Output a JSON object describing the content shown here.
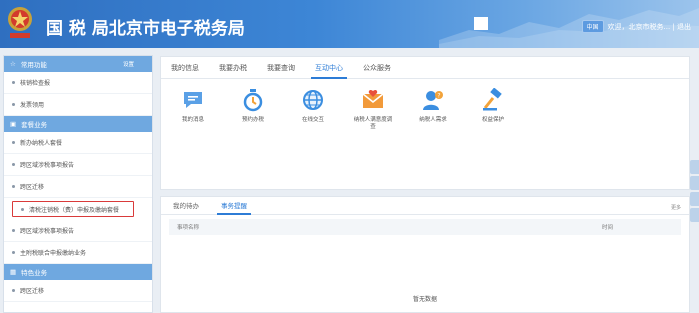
{
  "header": {
    "title": "国 税 局北京市电子税务局",
    "user_pill": "中国",
    "user_links": "欢迎，北京市税务... | 退出"
  },
  "sidebar": {
    "section1": {
      "icon": "star-icon",
      "title": "常用功能",
      "right": "设置"
    },
    "items1": [
      {
        "label": "核销检查报"
      },
      {
        "label": "发票领用"
      }
    ],
    "section2": {
      "icon": "briefcase-icon",
      "title": "套餐业务"
    },
    "items2": [
      {
        "label": "新办纳税人套餐"
      },
      {
        "label": "跨区域涉税事项报告"
      },
      {
        "label": "跨区迁移"
      },
      {
        "label": "清税注销税（费）申报及缴纳套餐"
      },
      {
        "label": "跨区域涉税事项报告"
      },
      {
        "label": "主附税联合申报缴纳业务"
      }
    ],
    "section3": {
      "icon": "grid-icon",
      "title": "特色业务"
    },
    "items3": [
      {
        "label": "跨区迁移"
      }
    ]
  },
  "main": {
    "tabs": [
      "我的信息",
      "我要办税",
      "我要查询",
      "互动中心",
      "公众服务"
    ],
    "active_tab": 3,
    "icons": [
      {
        "label": "我的消息",
        "icon": "message-icon"
      },
      {
        "label": "预约办税",
        "icon": "timer-icon"
      },
      {
        "label": "在线交互",
        "icon": "globe-icon"
      },
      {
        "label": "纳税人满意度调查",
        "icon": "envelope-icon"
      },
      {
        "label": "纳税人需求",
        "icon": "user-question-icon"
      },
      {
        "label": "权益保护",
        "icon": "gavel-icon"
      }
    ]
  },
  "bottom": {
    "tabs": [
      "我的待办",
      "事务提醒"
    ],
    "active_tab": 1,
    "more": "更多",
    "col_left": "事项名称",
    "col_right": "时间",
    "empty": "暂无数据"
  },
  "colors": {
    "brand_blue": "#2d7cd6",
    "sidebar_head": "#6fa8e0",
    "highlight_border": "#d93a3a"
  }
}
